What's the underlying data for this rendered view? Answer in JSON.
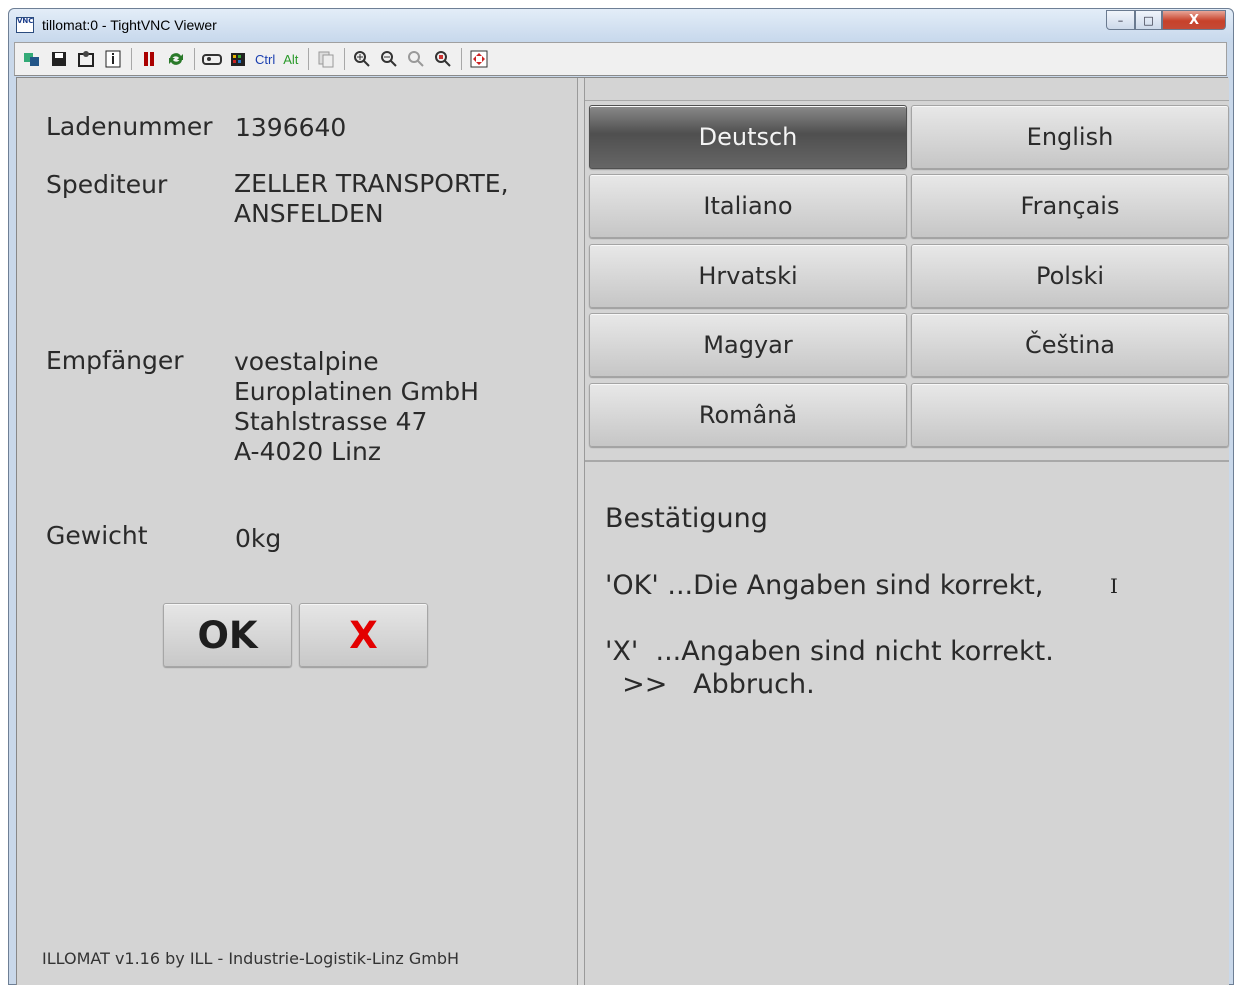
{
  "window": {
    "title": "tillomat:0 - TightVNC Viewer",
    "icon_label": "VNC",
    "controls": {
      "minimize": "–",
      "maximize": "□",
      "close": "X"
    }
  },
  "toolbar": {
    "icons": [
      "new-connection-icon",
      "save-icon",
      "options-icon",
      "info-icon",
      "pause-icon",
      "refresh-icon",
      "send-keys-icon",
      "ctrl-alt-del-icon"
    ],
    "ctrl_label": "Ctrl",
    "alt_label": "Alt"
  },
  "shipment": {
    "load_number_label": "Ladenummer",
    "load_number_value": "1396640",
    "carrier_label": "Spediteur",
    "carrier_lines": [
      "ZELLER TRANSPORTE,",
      "ANSFELDEN"
    ],
    "recipient_label": "Empfänger",
    "recipient_lines": [
      "voestalpine",
      "Europlatinen GmbH",
      "Stahlstrasse 47",
      "A-4020 Linz"
    ],
    "weight_label": "Gewicht",
    "weight_value": "0kg"
  },
  "actions": {
    "ok_label": "OK",
    "cancel_label": "X"
  },
  "footer": "ILLOMAT v1.16 by ILL - Industrie-Logistik-Linz GmbH",
  "languages": [
    {
      "label": "Deutsch",
      "active": true
    },
    {
      "label": "English"
    },
    {
      "label": "Italiano"
    },
    {
      "label": "Français"
    },
    {
      "label": "Hrvatski"
    },
    {
      "label": "Polski"
    },
    {
      "label": "Magyar"
    },
    {
      "label": "Čeština"
    },
    {
      "label": "Română"
    },
    {
      "label": ""
    }
  ],
  "confirmation": {
    "heading": "Bestätigung",
    "ok_line": "'OK' ...Die Angaben sind korrekt,",
    "x_line": "'X'  ...Angaben sind nicht korrekt.",
    "abort_line": "  >>   Abbruch."
  },
  "colors": {
    "cancel_red": "#e30000",
    "active_language_bg": "#5a5a5a"
  }
}
